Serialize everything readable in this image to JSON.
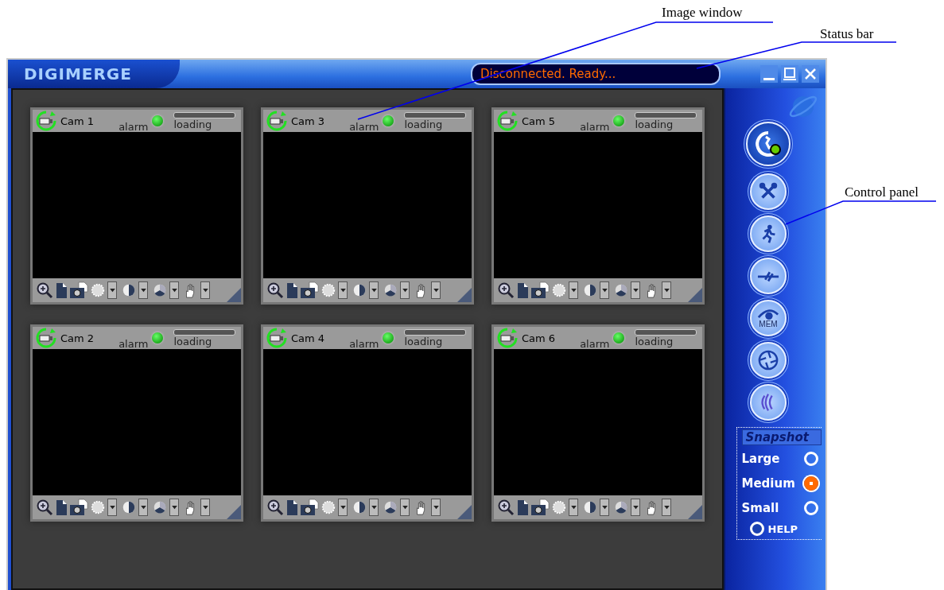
{
  "callouts": [
    {
      "label": "Image window"
    },
    {
      "label": "Status bar"
    },
    {
      "label": "Control panel"
    }
  ],
  "window": {
    "logo": "DIGIMERGE",
    "status": "Disconnected. Ready..."
  },
  "cameras": [
    {
      "name": "Cam 1",
      "alarm_label": "alarm",
      "loading_label": "loading",
      "level": 0
    },
    {
      "name": "Cam 3",
      "alarm_label": "alarm",
      "loading_label": "loading",
      "level": 0
    },
    {
      "name": "Cam 5",
      "alarm_label": "alarm",
      "loading_label": "loading",
      "level": 0
    },
    {
      "name": "Cam 2",
      "alarm_label": "alarm",
      "loading_label": "loading",
      "level": 0
    },
    {
      "name": "Cam 4",
      "alarm_label": "alarm",
      "loading_label": "loading",
      "level": 0
    },
    {
      "name": "Cam 6",
      "alarm_label": "alarm",
      "loading_label": "loading",
      "level": 0
    }
  ],
  "control_panel": {
    "buttons": [
      {
        "kind": "connect"
      },
      {
        "kind": "settings"
      },
      {
        "kind": "motion"
      },
      {
        "kind": "disconnect"
      },
      {
        "kind": "memory",
        "label": "MEM"
      },
      {
        "kind": "shutter"
      },
      {
        "kind": "audio"
      }
    ],
    "snapshot": {
      "title": "Snapshot",
      "sizes": [
        {
          "label": "Large",
          "selected": false
        },
        {
          "label": "Medium",
          "selected": true
        },
        {
          "label": "Small",
          "selected": false
        }
      ]
    },
    "help": "HELP"
  }
}
